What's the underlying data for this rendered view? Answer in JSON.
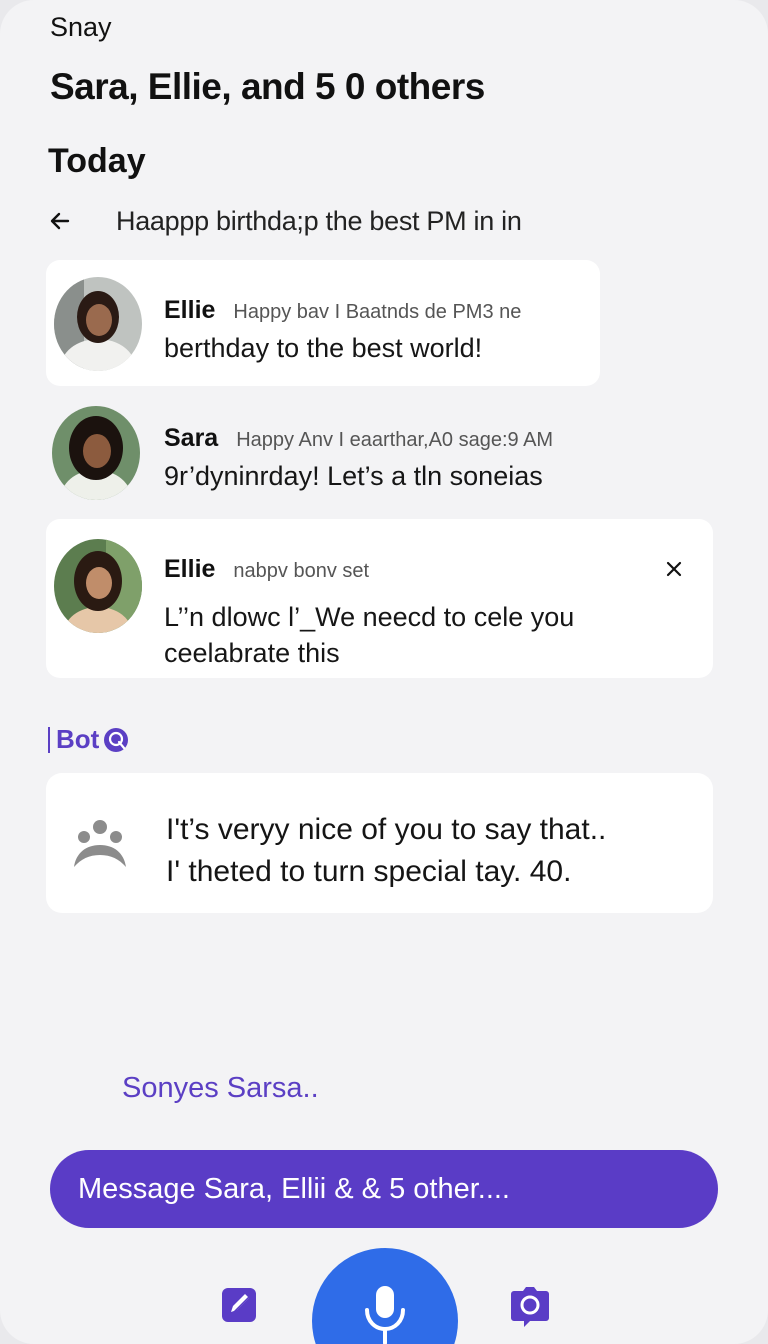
{
  "app": {
    "name": "Snay"
  },
  "chat": {
    "title": "Sara, Ellie, and 5 0 others",
    "section": "Today",
    "thread_subject": "Haappp birthda;p the best PM in in"
  },
  "messages": [
    {
      "sender": "Ellie",
      "meta": "Happy bav I Baatnds de PM3 ne",
      "lines": [
        "berthday to the best world!"
      ]
    },
    {
      "sender": "Sara",
      "meta": "Happy Anv I eaarthar,A0 sage:9 AM",
      "lines": [
        "9r’dyninrday! Let’s a  tln soneias"
      ]
    },
    {
      "sender": "Ellie",
      "meta": "nabpv bonv set",
      "lines": [
        "L’’n dlowc l’_We neecd to cele you",
        "ceelabrate this"
      ]
    }
  ],
  "bot": {
    "label": "Bot",
    "lines": [
      "I't’s veryy nice of you to say that..",
      "I' theted to turn special tay. 40."
    ]
  },
  "suggestion": "Sonyes Sarsa..",
  "composer": {
    "placeholder": "Message Sara, Ellii & & 5 other...."
  },
  "icons": {
    "back": "arrow-left-icon",
    "close": "close-icon",
    "bot_badge": "bot-badge-icon",
    "group": "group-icon",
    "edit": "edit-icon",
    "mic": "microphone-icon",
    "camera": "camera-icon"
  },
  "colors": {
    "accent": "#5a3cc6",
    "mic": "#2f6ce8",
    "background": "#f3f3f5",
    "card": "#ffffff"
  }
}
